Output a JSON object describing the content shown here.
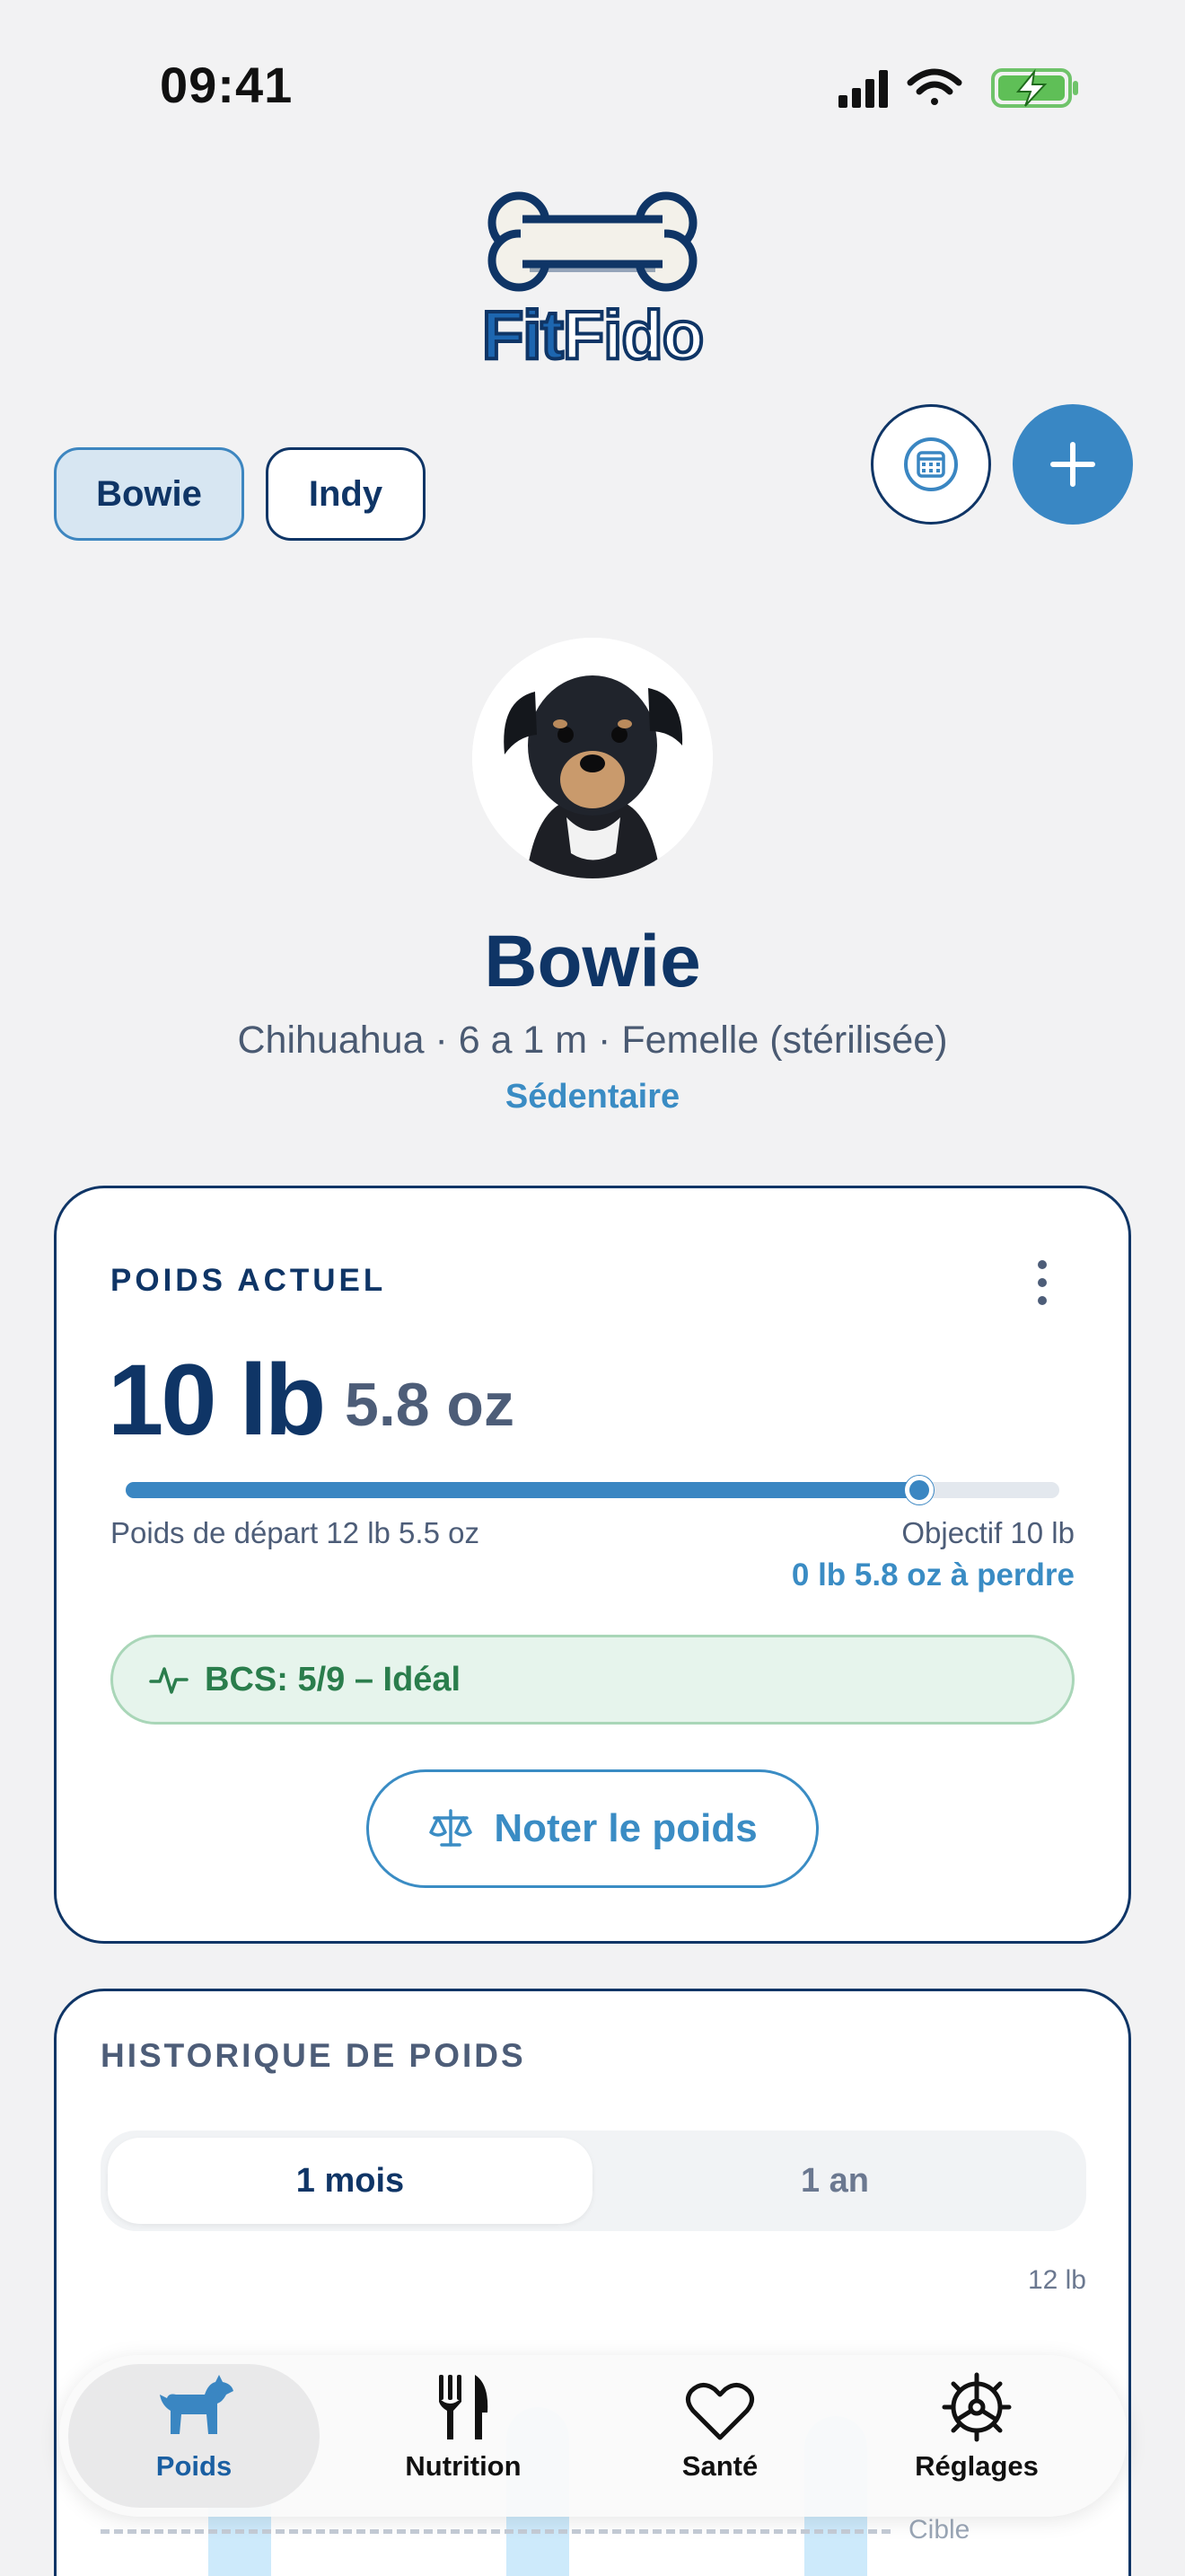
{
  "status_bar": {
    "time": "09:41"
  },
  "logo": {
    "part1": "Fit",
    "part2": "Fido"
  },
  "dogs": [
    {
      "label": "Bowie",
      "selected": true
    },
    {
      "label": "Indy",
      "selected": false
    }
  ],
  "profile": {
    "name": "Bowie",
    "meta": "Chihuahua · 6 a 1 m · Femelle (stérilisée)",
    "activity": "Sédentaire"
  },
  "weight_card": {
    "title": "POIDS ACTUEL",
    "weight_lb": "10 lb",
    "weight_oz": "5.8 oz",
    "progress": 0.85,
    "start": "Poids de départ 12 lb 5.5 oz",
    "goal": "Objectif 10 lb",
    "to_lose": "0 lb 5.8 oz à perdre",
    "bcs": "BCS: 5/9 – Idéal",
    "log_button": "Noter le poids"
  },
  "history_card": {
    "title": "HISTORIQUE DE POIDS",
    "tabs": [
      "1 mois",
      "1 an"
    ],
    "selected_tab": "1 mois",
    "y_max_label": "12 lb",
    "target_label": "Cible"
  },
  "tab_bar": [
    {
      "label": "Poids",
      "icon": "dog-icon",
      "active": true
    },
    {
      "label": "Nutrition",
      "icon": "fork-knife-icon",
      "active": false
    },
    {
      "label": "Santé",
      "icon": "heart-icon",
      "active": false
    },
    {
      "label": "Réglages",
      "icon": "gear-icon",
      "active": false
    }
  ],
  "colors": {
    "primary": "#0f3566",
    "accent": "#3a8cc4",
    "success": "#2a7d4c",
    "background": "#f2f2f3"
  }
}
